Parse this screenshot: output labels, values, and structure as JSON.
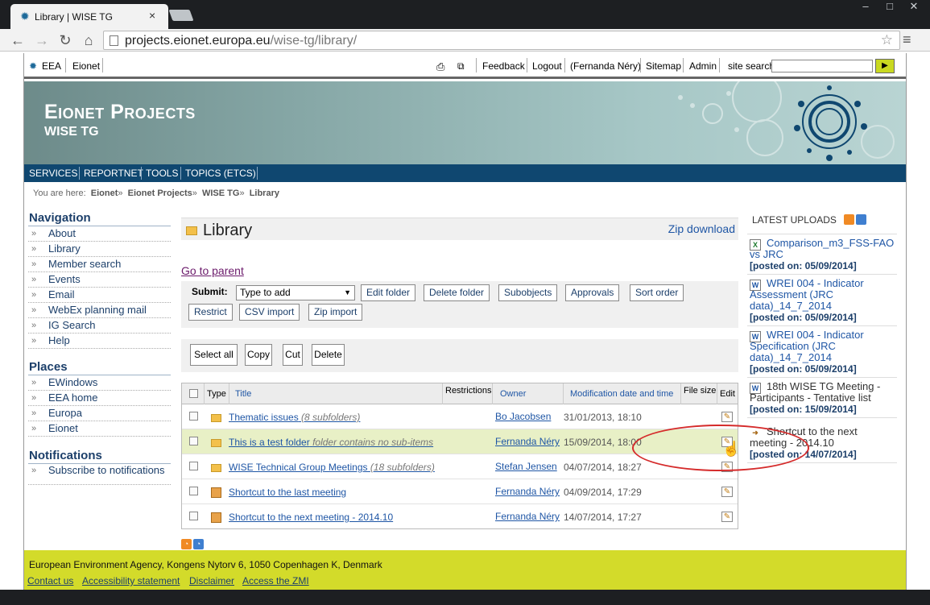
{
  "browser": {
    "tab_title": "Library | WISE TG",
    "tab_close": "×",
    "url_host": "projects.eionet.europa.eu",
    "url_path": "/wise-tg/library/",
    "back_icon": "←",
    "forward_icon": "→",
    "reload_icon": "↻",
    "home_icon": "⌂",
    "star_icon": "☆",
    "menu_icon": "≡",
    "win_min": "–",
    "win_max": "□",
    "win_close": "✕"
  },
  "topbar": {
    "eea": "EEA",
    "eionet": "Eionet",
    "feedback": "Feedback",
    "logout": "Logout",
    "user": "(Fernanda Néry)",
    "sitemap": "Sitemap",
    "admin": "Admin",
    "site_search": "site search",
    "go": "▶"
  },
  "banner": {
    "title": "Eionet Projects",
    "subtitle": "WISE TG"
  },
  "mainnav": {
    "services": "SERVICES",
    "reportnet": "REPORTNET",
    "tools": "TOOLS",
    "topics": "TOPICS (ETCS)"
  },
  "breadcrumbs": {
    "prefix": "You are here:",
    "items": [
      "Eionet",
      "Eionet Projects",
      "WISE TG",
      "Library"
    ],
    "sep": "»"
  },
  "navigation": {
    "heading": "Navigation",
    "items": [
      "About",
      "Library",
      "Member search",
      "Events",
      "Email",
      "WebEx planning mail",
      "IG Search",
      "Help"
    ]
  },
  "places": {
    "heading": "Places",
    "items": [
      "EWindows",
      "EEA home",
      "Europa",
      "Eionet"
    ]
  },
  "notifications": {
    "heading": "Notifications",
    "items": [
      "Subscribe to notifications"
    ]
  },
  "library": {
    "title": "Library",
    "zip_download": "Zip download",
    "go_to_parent": "Go to parent",
    "submit_label": "Submit:",
    "select_value": "Type to add",
    "buttons": {
      "edit_folder": "Edit folder",
      "delete_folder": "Delete folder",
      "subobjects": "Subobjects",
      "approvals": "Approvals",
      "sort_order": "Sort order",
      "restrict": "Restrict",
      "csv_import": "CSV import",
      "zip_import": "Zip import"
    },
    "actions": {
      "select_all": "Select all",
      "copy": "Copy",
      "cut": "Cut",
      "delete": "Delete"
    },
    "columns": {
      "type": "Type",
      "title": "Title",
      "restrictions": "Restrictions",
      "owner": "Owner",
      "modified": "Modification date and time",
      "file_size": "File size",
      "edit": "Edit"
    },
    "rows": [
      {
        "kind": "folder",
        "title": "Thematic issues",
        "note": "(8 subfolders)",
        "owner": "Bo Jacobsen",
        "date": "31/01/2013, 18:10"
      },
      {
        "kind": "folder",
        "title": "This is a test folder",
        "note": "folder contains no sub-items",
        "owner": "Fernanda Néry",
        "date": "15/09/2014, 18:00"
      },
      {
        "kind": "folder",
        "title": "WISE Technical Group Meetings",
        "note": "(18 subfolders)",
        "owner": "Stefan Jensen",
        "date": "04/07/2014, 18:27"
      },
      {
        "kind": "shortcut",
        "title": "Shortcut to the last meeting",
        "note": "",
        "owner": "Fernanda Néry",
        "date": "04/09/2014, 17:29"
      },
      {
        "kind": "shortcut",
        "title": "Shortcut to the next meeting - 2014.10",
        "note": "",
        "owner": "Fernanda Néry",
        "date": "14/07/2014, 17:27"
      }
    ]
  },
  "latest": {
    "heading": "LATEST UPLOADS",
    "items": [
      {
        "icon": "X",
        "title": "Comparison_m3_FSS-FAO vs JRC",
        "posted": "[posted on: 05/09/2014]",
        "link": true
      },
      {
        "icon": "W",
        "title": "WREI 004 - Indicator Assessment (JRC data)_14_7_2014",
        "posted": "[posted on: 05/09/2014]",
        "link": true
      },
      {
        "icon": "W",
        "title": "WREI 004 - Indicator Specification (JRC data)_14_7_2014",
        "posted": "[posted on: 05/09/2014]",
        "link": true
      },
      {
        "icon": "W",
        "title": "18th WISE TG Meeting - Participants - Tentative list",
        "posted": "[posted on: 15/09/2014]",
        "link": false
      },
      {
        "icon": "➜",
        "title": "Shortcut to the next meeting - 2014.10",
        "posted": "[posted on: 14/07/2014]",
        "link": false
      }
    ]
  },
  "footer": {
    "address": "European Environment Agency, Kongens Nytorv 6, 1050 Copenhagen K, Denmark",
    "links": [
      "Contact us",
      "Accessibility statement",
      "Disclaimer",
      "Access the ZMI"
    ]
  },
  "colors": {
    "nav_bar": "#0f4770",
    "footer": "#d3db2a",
    "highlight_row": "#e8f0c6",
    "annotation": "#d52b2b"
  }
}
